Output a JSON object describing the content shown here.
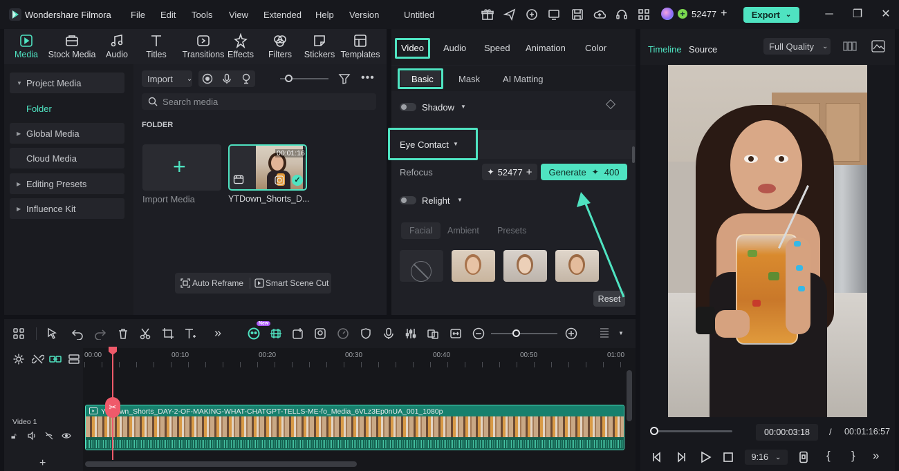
{
  "app": {
    "name": "Wondershare Filmora",
    "doc_title": "Untitled",
    "credits": "52477",
    "export_label": "Export"
  },
  "menu": [
    "File",
    "Edit",
    "Tools",
    "View",
    "Extended",
    "Help",
    "Version"
  ],
  "media_tabs": [
    "Media",
    "Stock Media",
    "Audio",
    "Titles",
    "Transitions",
    "Effects",
    "Filters",
    "Stickers",
    "Templates"
  ],
  "sidebar": {
    "project_media": "Project Media",
    "folder": "Folder",
    "global_media": "Global Media",
    "cloud_media": "Cloud Media",
    "editing_presets": "Editing Presets",
    "influence_kit": "Influence Kit"
  },
  "media": {
    "import_label": "Import",
    "search_placeholder": "Search media",
    "folder_heading": "FOLDER",
    "import_tile_label": "Import Media",
    "clip_duration": "00:01:16",
    "clip_name": "YTDown_Shorts_D...",
    "auto_reframe": "Auto Reframe",
    "smart_scene_cut": "Smart Scene Cut"
  },
  "props": {
    "tabs": [
      "Video",
      "Audio",
      "Speed",
      "Animation",
      "Color"
    ],
    "subtabs": [
      "Basic",
      "Mask",
      "AI Matting"
    ],
    "shadow": "Shadow",
    "eye_contact": "Eye Contact",
    "refocus": "Refocus",
    "refocus_credits": "52477",
    "generate_label": "Generate",
    "generate_cost": "400",
    "relight": "Relight",
    "relight_chips": [
      "Facial",
      "Ambient",
      "Presets"
    ],
    "reset_label": "Reset"
  },
  "player": {
    "tab_timeline": "Timeline",
    "tab_source": "Source",
    "quality": "Full Quality",
    "current_time": "00:00:03:18",
    "separator": "/",
    "total_time": "00:01:16:57",
    "ratio": "9:16",
    "progress": 0.05
  },
  "timeline": {
    "ruler": [
      "00:00",
      "00:10",
      "00:20",
      "00:30",
      "00:40",
      "00:50",
      "01:00"
    ],
    "track_label": "Video 1",
    "clip_title": "YTDown_Shorts_DAY-2-OF-MAKING-WHAT-CHATGPT-TELLS-ME-fo_Media_6VLz3Ep0nUA_001_1080p",
    "new_badge": "New"
  },
  "colors": {
    "accent": "#4fe3c1",
    "playhead": "#ef5a6a",
    "panel": "#1f2026"
  }
}
